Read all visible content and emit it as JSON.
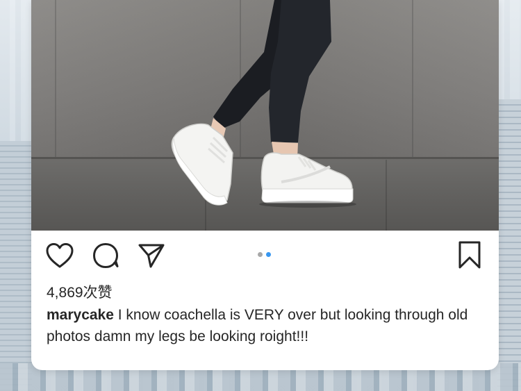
{
  "post": {
    "likes_text": "4,869次赞",
    "username": "marycake",
    "caption": "I know coachella is VERY over but looking through old photos damn my legs be looking roight!!!",
    "carousel": {
      "count": 2,
      "active_index": 1
    }
  },
  "icons": {
    "like": "heart-icon",
    "comment": "comment-bubble-icon",
    "share": "paper-plane-icon",
    "save": "bookmark-icon"
  },
  "colors": {
    "text": "#262626",
    "carousel_active": "#3897f0",
    "carousel_inactive": "#a8a8a8"
  }
}
